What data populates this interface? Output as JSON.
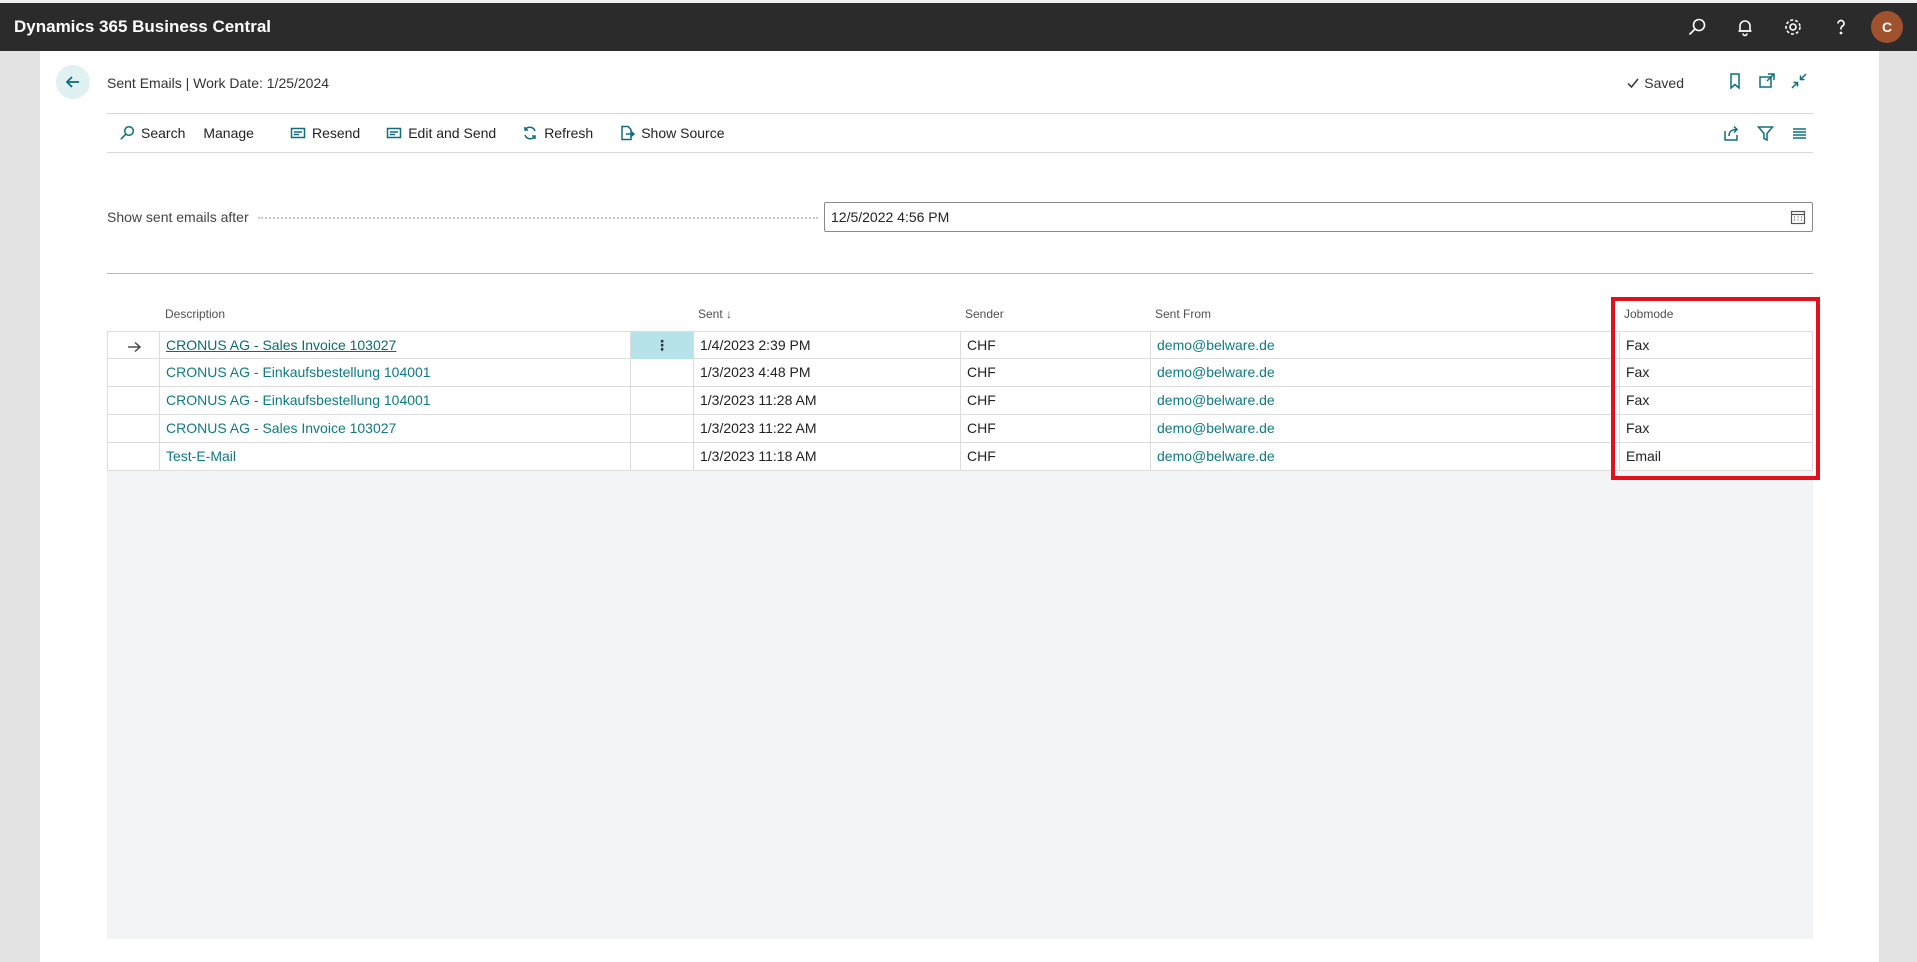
{
  "app": {
    "title": "Dynamics 365 Business Central",
    "avatar_initial": "C"
  },
  "topbar_icons": [
    "search-icon",
    "bell-icon",
    "gear-icon",
    "help-icon"
  ],
  "page": {
    "title": "Sent Emails | Work Date: 1/25/2024",
    "saved_label": "Saved"
  },
  "actions": {
    "search": "Search",
    "manage": "Manage",
    "resend": "Resend",
    "edit_and_send": "Edit and Send",
    "refresh": "Refresh",
    "show_source": "Show Source"
  },
  "filter": {
    "label": "Show sent emails after",
    "value": "12/5/2022 4:56 PM"
  },
  "grid": {
    "columns": {
      "description": "Description",
      "sent": "Sent",
      "sender": "Sender",
      "sent_from": "Sent From",
      "jobmode": "Jobmode"
    },
    "sort_indicator": "↓",
    "rows": [
      {
        "description": "CRONUS AG - Sales Invoice 103027",
        "sent": "1/4/2023 2:39 PM",
        "sender": "CHF",
        "sent_from": "demo@belware.de",
        "jobmode": "Fax"
      },
      {
        "description": "CRONUS AG - Einkaufsbestellung 104001",
        "sent": "1/3/2023 4:48 PM",
        "sender": "CHF",
        "sent_from": "demo@belware.de",
        "jobmode": "Fax"
      },
      {
        "description": "CRONUS AG - Einkaufsbestellung 104001",
        "sent": "1/3/2023 11:28 AM",
        "sender": "CHF",
        "sent_from": "demo@belware.de",
        "jobmode": "Fax"
      },
      {
        "description": "CRONUS AG - Sales Invoice 103027",
        "sent": "1/3/2023 11:22 AM",
        "sender": "CHF",
        "sent_from": "demo@belware.de",
        "jobmode": "Fax"
      },
      {
        "description": "Test-E-Mail",
        "sent": "1/3/2023 11:18 AM",
        "sender": "CHF",
        "sent_from": "demo@belware.de",
        "jobmode": "Email"
      }
    ],
    "row_menu_glyph": "⋮"
  },
  "colors": {
    "topbar": "#2b2b2b",
    "accent": "#0e7a85",
    "highlight": "#e0101c",
    "selected_menu_cell": "#b6e3e9"
  }
}
